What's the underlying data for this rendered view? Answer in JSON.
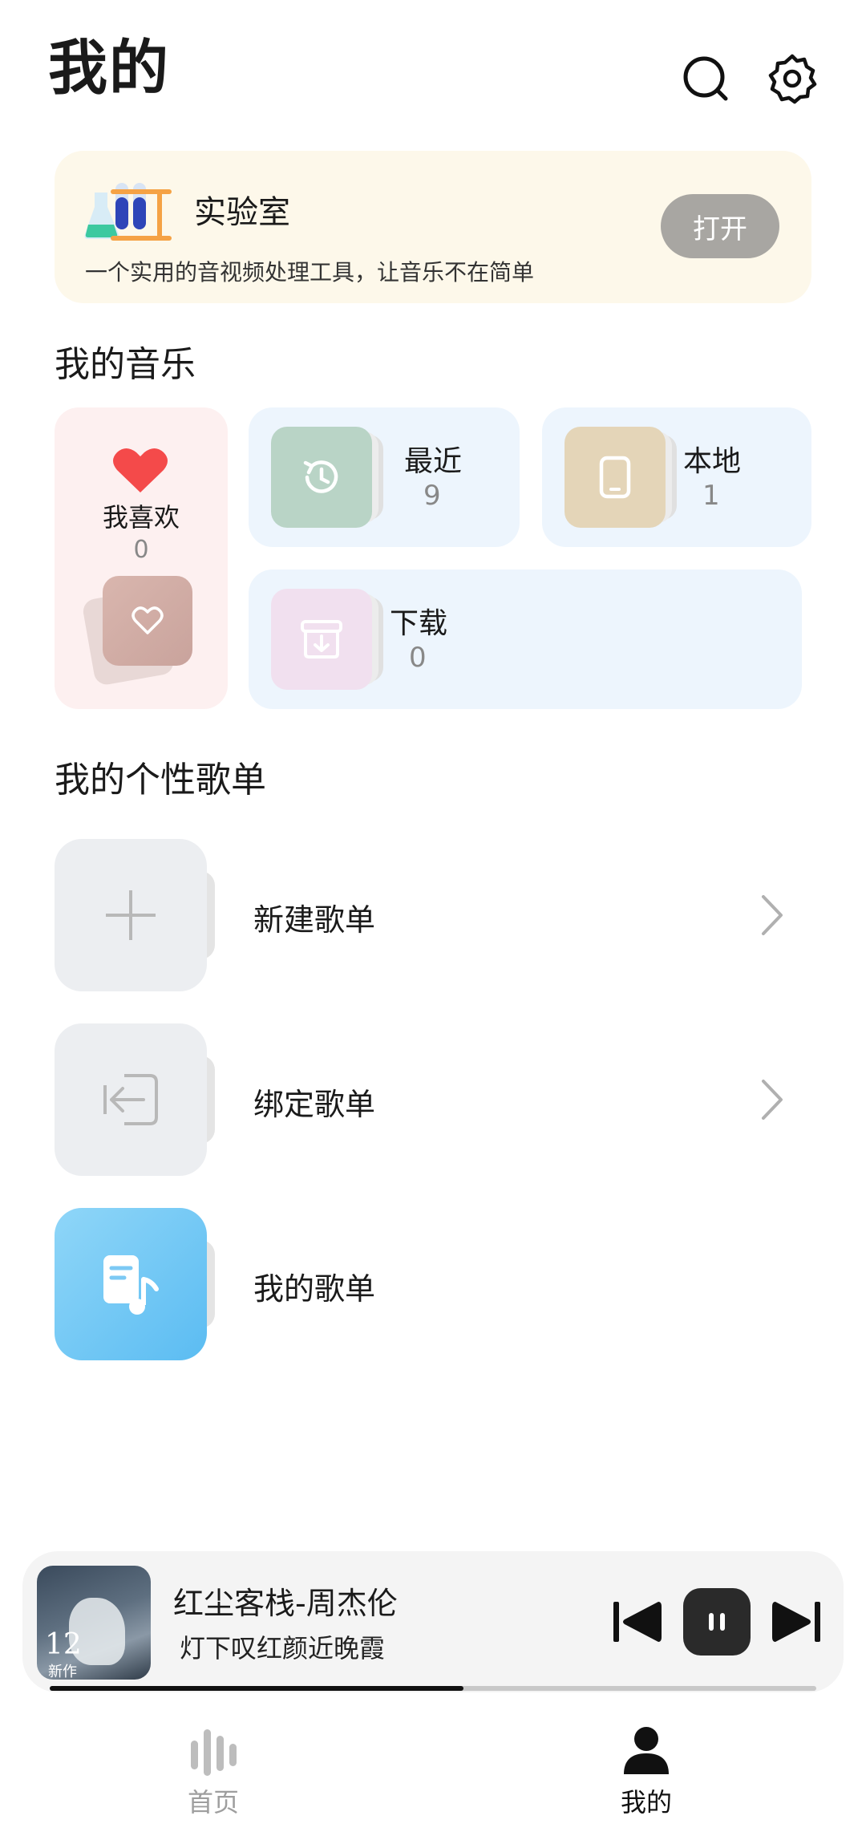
{
  "header": {
    "title": "我的"
  },
  "lab": {
    "title": "实验室",
    "description": "一个实用的音视频处理工具，让音乐不在简单",
    "open_label": "打开"
  },
  "my_music": {
    "section_title": "我的音乐",
    "favorites": {
      "label": "我喜欢",
      "count": "0"
    },
    "recent": {
      "label": "最近",
      "count": "9"
    },
    "local": {
      "label": "本地",
      "count": "1"
    },
    "downloads": {
      "label": "下载",
      "count": "0"
    }
  },
  "playlists": {
    "section_title": "我的个性歌单",
    "items": [
      {
        "label": "新建歌单",
        "icon": "plus-icon"
      },
      {
        "label": "绑定歌单",
        "icon": "import-icon"
      },
      {
        "label": "我的歌单",
        "icon": "music-note-icon"
      }
    ]
  },
  "player": {
    "title": "红尘客栈-周杰伦",
    "lyric": "灯下叹红颜近晚霞",
    "cover_number": "12",
    "cover_subtitle": "新作",
    "progress": 0.54
  },
  "nav": {
    "items": [
      {
        "label": "首页",
        "icon": "equalizer-icon",
        "active": false
      },
      {
        "label": "我的",
        "icon": "person-icon",
        "active": true
      }
    ]
  },
  "colors": {
    "lab_bg": "#fdf8ea",
    "tile_bg": "#edf5fd",
    "fav_bg": "#fdf0f0",
    "heart": "#f44a4a",
    "playlist_blue": "#6cc5f4"
  }
}
